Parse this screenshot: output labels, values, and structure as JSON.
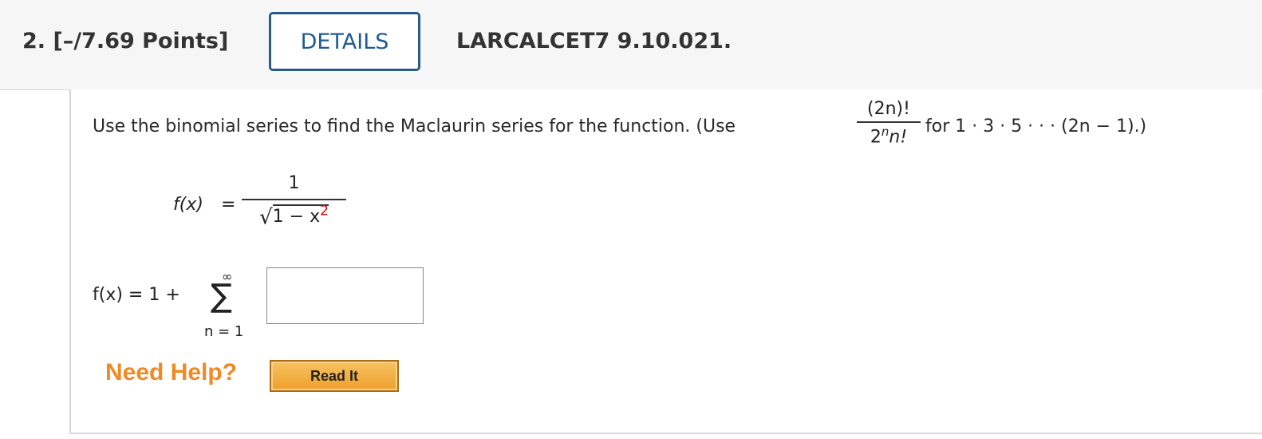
{
  "header": {
    "question_label": "2.  [–/7.69 Points]",
    "details_label": "DETAILS",
    "reference": "LARCALCET7 9.10.021."
  },
  "problem": {
    "prompt": "Use the binomial series to find the Maclaurin series for the function. (Use",
    "hint_numerator": "(2n)!",
    "hint_denominator_base": "2",
    "hint_denominator_exp": "n",
    "hint_denominator_tail": "n!",
    "prompt_tail": "for 1 · 3 · 5 · · · (2n − 1).)"
  },
  "function": {
    "lhs": "f(x)",
    "equals": "=",
    "numerator": "1",
    "radicand": "1 − x",
    "exponent": "2"
  },
  "series": {
    "lhs": "f(x) = 1 +",
    "upper": "∞",
    "sigma": "∑",
    "lower": "n = 1",
    "answer_value": ""
  },
  "help": {
    "need_help": "Need Help?",
    "read_it": "Read It"
  },
  "colors": {
    "details_border": "#2a5a8a",
    "need_help": "#f08a24",
    "exponent_red": "#dd0000"
  }
}
